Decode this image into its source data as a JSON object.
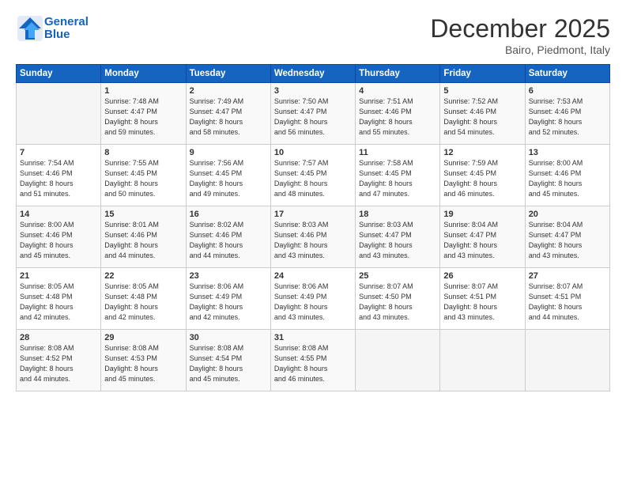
{
  "header": {
    "logo_line1": "General",
    "logo_line2": "Blue",
    "month": "December 2025",
    "location": "Bairo, Piedmont, Italy"
  },
  "days_of_week": [
    "Sunday",
    "Monday",
    "Tuesday",
    "Wednesday",
    "Thursday",
    "Friday",
    "Saturday"
  ],
  "weeks": [
    [
      {
        "day": "",
        "info": ""
      },
      {
        "day": "1",
        "info": "Sunrise: 7:48 AM\nSunset: 4:47 PM\nDaylight: 8 hours\nand 59 minutes."
      },
      {
        "day": "2",
        "info": "Sunrise: 7:49 AM\nSunset: 4:47 PM\nDaylight: 8 hours\nand 58 minutes."
      },
      {
        "day": "3",
        "info": "Sunrise: 7:50 AM\nSunset: 4:47 PM\nDaylight: 8 hours\nand 56 minutes."
      },
      {
        "day": "4",
        "info": "Sunrise: 7:51 AM\nSunset: 4:46 PM\nDaylight: 8 hours\nand 55 minutes."
      },
      {
        "day": "5",
        "info": "Sunrise: 7:52 AM\nSunset: 4:46 PM\nDaylight: 8 hours\nand 54 minutes."
      },
      {
        "day": "6",
        "info": "Sunrise: 7:53 AM\nSunset: 4:46 PM\nDaylight: 8 hours\nand 52 minutes."
      }
    ],
    [
      {
        "day": "7",
        "info": "Sunrise: 7:54 AM\nSunset: 4:46 PM\nDaylight: 8 hours\nand 51 minutes."
      },
      {
        "day": "8",
        "info": "Sunrise: 7:55 AM\nSunset: 4:45 PM\nDaylight: 8 hours\nand 50 minutes."
      },
      {
        "day": "9",
        "info": "Sunrise: 7:56 AM\nSunset: 4:45 PM\nDaylight: 8 hours\nand 49 minutes."
      },
      {
        "day": "10",
        "info": "Sunrise: 7:57 AM\nSunset: 4:45 PM\nDaylight: 8 hours\nand 48 minutes."
      },
      {
        "day": "11",
        "info": "Sunrise: 7:58 AM\nSunset: 4:45 PM\nDaylight: 8 hours\nand 47 minutes."
      },
      {
        "day": "12",
        "info": "Sunrise: 7:59 AM\nSunset: 4:45 PM\nDaylight: 8 hours\nand 46 minutes."
      },
      {
        "day": "13",
        "info": "Sunrise: 8:00 AM\nSunset: 4:46 PM\nDaylight: 8 hours\nand 45 minutes."
      }
    ],
    [
      {
        "day": "14",
        "info": "Sunrise: 8:00 AM\nSunset: 4:46 PM\nDaylight: 8 hours\nand 45 minutes."
      },
      {
        "day": "15",
        "info": "Sunrise: 8:01 AM\nSunset: 4:46 PM\nDaylight: 8 hours\nand 44 minutes."
      },
      {
        "day": "16",
        "info": "Sunrise: 8:02 AM\nSunset: 4:46 PM\nDaylight: 8 hours\nand 44 minutes."
      },
      {
        "day": "17",
        "info": "Sunrise: 8:03 AM\nSunset: 4:46 PM\nDaylight: 8 hours\nand 43 minutes."
      },
      {
        "day": "18",
        "info": "Sunrise: 8:03 AM\nSunset: 4:47 PM\nDaylight: 8 hours\nand 43 minutes."
      },
      {
        "day": "19",
        "info": "Sunrise: 8:04 AM\nSunset: 4:47 PM\nDaylight: 8 hours\nand 43 minutes."
      },
      {
        "day": "20",
        "info": "Sunrise: 8:04 AM\nSunset: 4:47 PM\nDaylight: 8 hours\nand 43 minutes."
      }
    ],
    [
      {
        "day": "21",
        "info": "Sunrise: 8:05 AM\nSunset: 4:48 PM\nDaylight: 8 hours\nand 42 minutes."
      },
      {
        "day": "22",
        "info": "Sunrise: 8:05 AM\nSunset: 4:48 PM\nDaylight: 8 hours\nand 42 minutes."
      },
      {
        "day": "23",
        "info": "Sunrise: 8:06 AM\nSunset: 4:49 PM\nDaylight: 8 hours\nand 42 minutes."
      },
      {
        "day": "24",
        "info": "Sunrise: 8:06 AM\nSunset: 4:49 PM\nDaylight: 8 hours\nand 43 minutes."
      },
      {
        "day": "25",
        "info": "Sunrise: 8:07 AM\nSunset: 4:50 PM\nDaylight: 8 hours\nand 43 minutes."
      },
      {
        "day": "26",
        "info": "Sunrise: 8:07 AM\nSunset: 4:51 PM\nDaylight: 8 hours\nand 43 minutes."
      },
      {
        "day": "27",
        "info": "Sunrise: 8:07 AM\nSunset: 4:51 PM\nDaylight: 8 hours\nand 44 minutes."
      }
    ],
    [
      {
        "day": "28",
        "info": "Sunrise: 8:08 AM\nSunset: 4:52 PM\nDaylight: 8 hours\nand 44 minutes."
      },
      {
        "day": "29",
        "info": "Sunrise: 8:08 AM\nSunset: 4:53 PM\nDaylight: 8 hours\nand 45 minutes."
      },
      {
        "day": "30",
        "info": "Sunrise: 8:08 AM\nSunset: 4:54 PM\nDaylight: 8 hours\nand 45 minutes."
      },
      {
        "day": "31",
        "info": "Sunrise: 8:08 AM\nSunset: 4:55 PM\nDaylight: 8 hours\nand 46 minutes."
      },
      {
        "day": "",
        "info": ""
      },
      {
        "day": "",
        "info": ""
      },
      {
        "day": "",
        "info": ""
      }
    ]
  ]
}
